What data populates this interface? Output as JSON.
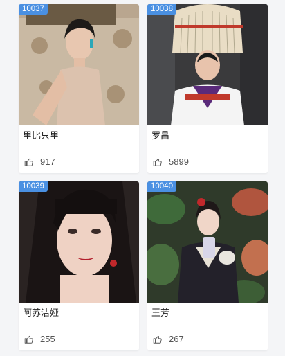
{
  "cards": [
    {
      "id": "10037",
      "name": "里比只里",
      "likes": "917"
    },
    {
      "id": "10038",
      "name": "罗昌",
      "likes": "5899"
    },
    {
      "id": "10039",
      "name": "阿苏洁娅",
      "likes": "255"
    },
    {
      "id": "10040",
      "name": "王芳",
      "likes": "267"
    }
  ],
  "icons": {
    "like": "thumbs-up-icon"
  },
  "colors": {
    "badge": "#4a90e2",
    "background": "#f4f5f7",
    "card": "#ffffff"
  }
}
